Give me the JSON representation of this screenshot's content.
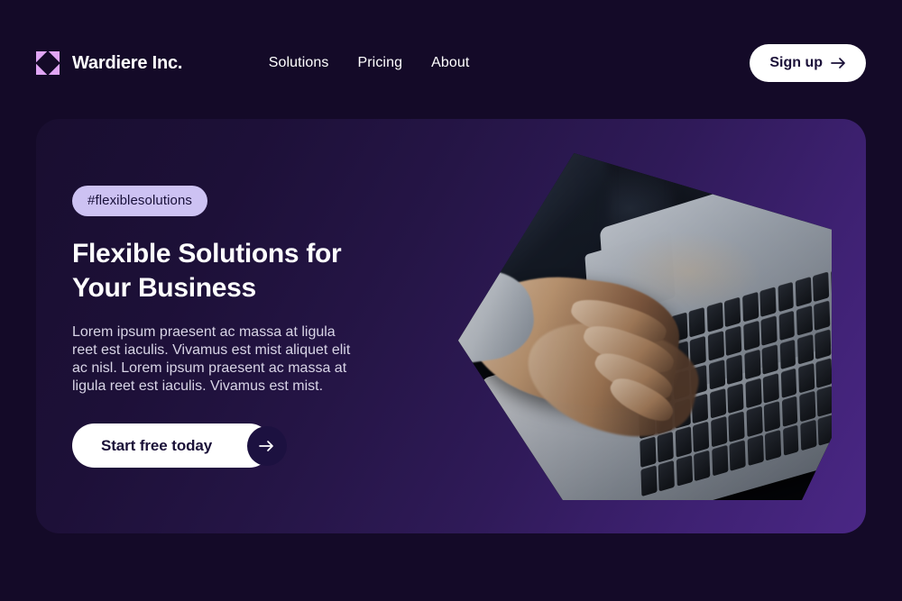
{
  "brand": {
    "name": "Wardiere Inc.",
    "logo_icon": "triangle-grid-logo-icon",
    "logo_color": "#e0a6f5"
  },
  "nav": {
    "links": [
      {
        "label": "Solutions"
      },
      {
        "label": "Pricing"
      },
      {
        "label": "About"
      }
    ],
    "signup": {
      "label": "Sign up",
      "icon": "arrow-right-icon",
      "bg": "#ffffff",
      "text_color": "#1a1038"
    }
  },
  "hero": {
    "tag": "#flexiblesolutions",
    "tag_bg": "#cdc2f3",
    "title_line1": "Flexible Solutions for",
    "title_line2": "Your Business",
    "description": "Lorem ipsum praesent ac massa at ligula reet est iaculis. Vivamus est mist aliquet elit ac nisl. Lorem ipsum praesent ac massa at ligula reet est iaculis. Vivamus est mist.",
    "cta": {
      "label": "Start free today",
      "icon": "arrow-right-icon",
      "bg": "#ffffff",
      "text_color": "#1a1038",
      "badge_bg": "#1c1140"
    },
    "image_alt": "hands-typing-on-laptop-photo",
    "card_gradient_from": "#190e30",
    "card_gradient_to": "#4a2785"
  },
  "page": {
    "background": "#140a28"
  }
}
